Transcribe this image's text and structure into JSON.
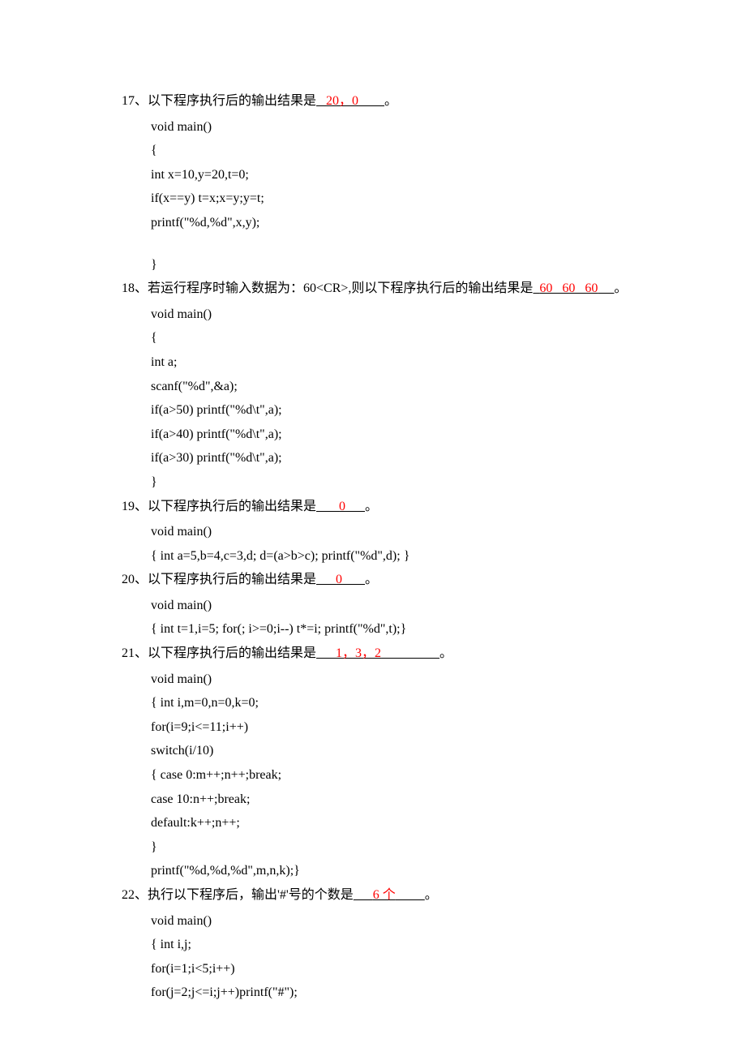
{
  "q17": {
    "prefix": "17、以下程序执行后的输出结果是",
    "blank_left": "   ",
    "answer": "20，0",
    "blank_right": "        ",
    "suffix": "。",
    "code": [
      "void main()",
      "{",
      "      int x=10,y=20,t=0;",
      "      if(x==y) t=x;x=y;y=t;",
      "      printf(\"%d,%d\",x,y);",
      "",
      "}"
    ]
  },
  "q18": {
    "prefix": "18、若运行程序时输入数据为：60<CR>,则以下程序执行后的输出结果是",
    "blank_left": "  ",
    "answer": "60   60   60",
    "blank_right": "     ",
    "suffix": "。",
    "code": [
      "void main()",
      "{",
      "      int a;",
      "      scanf(\"%d\",&a);",
      "      if(a>50) printf(\"%d\\t\",a);",
      "      if(a>40) printf(\"%d\\t\",a);",
      "      if(a>30) printf(\"%d\\t\",a);",
      "}"
    ]
  },
  "q19": {
    "prefix": "19、以下程序执行后的输出结果是",
    "blank_left": "       ",
    "answer": "0",
    "blank_right": "      ",
    "suffix": "。",
    "code": [
      "void main()",
      "{      int a=5,b=4,c=3,d;     d=(a>b>c); printf(\"%d\",d);   }"
    ]
  },
  "q20": {
    "prefix": "20、以下程序执行后的输出结果是",
    "blank_left": "      ",
    "answer": "0",
    "blank_right": "       ",
    "suffix": "。",
    "code": [
      "void main()",
      "{      int t=1,i=5; for(; i>=0;i--) t*=i; printf(\"%d\",t);}"
    ]
  },
  "q21": {
    "prefix": "21、以下程序执行后的输出结果是",
    "blank_left": "      ",
    "answer": "1，3，2",
    "blank_right": "                  ",
    "suffix": "。",
    "code": [
      "void main()",
      "{      int i,m=0,n=0,k=0;",
      "for(i=9;i<=11;i++)",
      "switch(i/10)",
      "{      case 0:m++;n++;break;",
      "       case 10:n++;break;",
      "       default:k++;n++;",
      "}",
      "printf(\"%d,%d,%d\",m,n,k);}"
    ]
  },
  "q22": {
    "prefix": "22、执行以下程序后，输出'#'号的个数是",
    "blank_left": "      ",
    "answer": "6 个",
    "blank_right": "         ",
    "suffix": "。",
    "code": [
      "void main()",
      "{      int i,j;",
      "       for(i=1;i<5;i++)",
      "         for(j=2;j<=i;j++)printf(\"#\");"
    ]
  }
}
